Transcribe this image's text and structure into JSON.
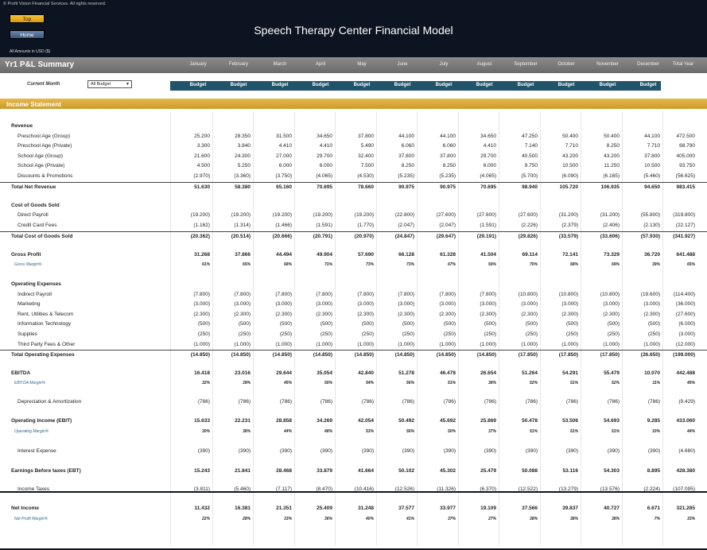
{
  "header": {
    "copyright": "© Profit Vision Financial Services. All rights reserved.",
    "top_button": "Top",
    "home_button": "Home",
    "title": "Speech Therapy Center Financial Model",
    "amounts_note": "All Amounts in  USD ($)"
  },
  "summary": {
    "title": "Yr1 P&L Summary",
    "months": [
      "January",
      "February",
      "March",
      "April",
      "May",
      "June",
      "July",
      "August",
      "September",
      "October",
      "November",
      "December",
      "Total Year"
    ],
    "current_month_label": "Current Month",
    "dropdown_value": "All Budget",
    "budget_label": "Budget"
  },
  "section_title": "Income Statement",
  "rows": [
    {
      "label": "Revenue",
      "style": "head",
      "values": []
    },
    {
      "label": "Preschool Age (Group)",
      "style": "i1",
      "values": [
        "25.200",
        "28.350",
        "31.500",
        "34.650",
        "37.800",
        "44.100",
        "44.100",
        "34.650",
        "47.250",
        "50.400",
        "50.400",
        "44.100",
        "472.500"
      ]
    },
    {
      "label": "Preschool Age (Private)",
      "style": "i1",
      "values": [
        "3.300",
        "3.840",
        "4.410",
        "4.410",
        "5.490",
        "6.060",
        "6.060",
        "4.410",
        "7.140",
        "7.710",
        "8.250",
        "7.710",
        "68.790"
      ]
    },
    {
      "label": "School Age (Group)",
      "style": "i1",
      "values": [
        "21.600",
        "24.300",
        "27.000",
        "29.700",
        "32.400",
        "37.800",
        "37.800",
        "29.700",
        "40.500",
        "43.200",
        "43.200",
        "37.800",
        "405.000"
      ]
    },
    {
      "label": "School Age (Private)",
      "style": "i1",
      "values": [
        "4.500",
        "5.250",
        "6.000",
        "6.000",
        "7.500",
        "8.250",
        "8.250",
        "6.000",
        "9.750",
        "10.500",
        "11.250",
        "10.500",
        "93.750"
      ]
    },
    {
      "label": "Discounts & Promotions",
      "style": "i1",
      "values": [
        "(2.970)",
        "(3.360)",
        "(3.750)",
        "(4.065)",
        "(4.530)",
        "(5.235)",
        "(5.235)",
        "(4.065)",
        "(5.700)",
        "(6.090)",
        "(6.165)",
        "(5.460)",
        "(56.625)"
      ]
    },
    {
      "label": "Total Net Revenue",
      "style": "total",
      "values": [
        "51.630",
        "58.380",
        "65.160",
        "70.695",
        "78.660",
        "90.975",
        "90.975",
        "70.695",
        "98.940",
        "105.720",
        "106.935",
        "94.650",
        "983.415"
      ]
    },
    {
      "label": "Cost of Goods Sold",
      "style": "head",
      "values": []
    },
    {
      "label": "Direct Payroll",
      "style": "i1",
      "values": [
        "(19.200)",
        "(19.200)",
        "(19.200)",
        "(19.200)",
        "(19.200)",
        "(22.800)",
        "(27.600)",
        "(27.600)",
        "(27.600)",
        "(31.200)",
        "(31.200)",
        "(55.800)",
        "(319.800)"
      ]
    },
    {
      "label": "Credit Card Fees",
      "style": "i1",
      "values": [
        "(1.162)",
        "(1.314)",
        "(1.466)",
        "(1.591)",
        "(1.770)",
        "(2.047)",
        "(2.047)",
        "(1.591)",
        "(2.226)",
        "(2.379)",
        "(2.406)",
        "(2.130)",
        "(22.127)"
      ]
    },
    {
      "label": "Total Cost of Goods Sold",
      "style": "total",
      "values": [
        "(20.362)",
        "(20.514)",
        "(20.666)",
        "(20.791)",
        "(20.970)",
        "(24.847)",
        "(29.647)",
        "(29.191)",
        "(29.826)",
        "(33.579)",
        "(33.606)",
        "(57.930)",
        "(341.927)"
      ]
    },
    {
      "label": "Gross Profit",
      "style": "bold",
      "values": [
        "31.268",
        "37.866",
        "44.494",
        "49.904",
        "57.690",
        "66.128",
        "61.328",
        "41.504",
        "69.114",
        "72.141",
        "73.329",
        "36.720",
        "641.488"
      ]
    },
    {
      "label": "Gross Margin%",
      "style": "margin",
      "values": [
        "61%",
        "65%",
        "68%",
        "71%",
        "73%",
        "73%",
        "67%",
        "59%",
        "70%",
        "68%",
        "69%",
        "39%",
        "65%"
      ]
    },
    {
      "label": "Operating Expenses",
      "style": "head",
      "values": []
    },
    {
      "label": "Indirect Payroll",
      "style": "i1",
      "values": [
        "(7.800)",
        "(7.800)",
        "(7.800)",
        "(7.800)",
        "(7.800)",
        "(7.800)",
        "(7.800)",
        "(7.800)",
        "(10.800)",
        "(10.800)",
        "(10.800)",
        "(19.600)",
        "(114.400)"
      ]
    },
    {
      "label": "Marketing",
      "style": "i1",
      "values": [
        "(3.000)",
        "(3.000)",
        "(3.000)",
        "(3.000)",
        "(3.000)",
        "(3.000)",
        "(3.000)",
        "(3.000)",
        "(3.000)",
        "(3.000)",
        "(3.000)",
        "(3.000)",
        "(36.000)"
      ]
    },
    {
      "label": "Rent, Utilities & Telecom",
      "style": "i1",
      "values": [
        "(2.300)",
        "(2.300)",
        "(2.300)",
        "(2.300)",
        "(2.300)",
        "(2.300)",
        "(2.300)",
        "(2.300)",
        "(2.300)",
        "(2.300)",
        "(2.300)",
        "(2.300)",
        "(27.600)"
      ]
    },
    {
      "label": "Information Technology",
      "style": "i1",
      "values": [
        "(500)",
        "(500)",
        "(500)",
        "(500)",
        "(500)",
        "(500)",
        "(500)",
        "(500)",
        "(500)",
        "(500)",
        "(500)",
        "(500)",
        "(6.000)"
      ]
    },
    {
      "label": "Supplies",
      "style": "i1",
      "values": [
        "(250)",
        "(250)",
        "(250)",
        "(250)",
        "(250)",
        "(250)",
        "(250)",
        "(250)",
        "(250)",
        "(250)",
        "(250)",
        "(250)",
        "(3.000)"
      ]
    },
    {
      "label": "Third Party Fees & Other",
      "style": "i1",
      "values": [
        "(1.000)",
        "(1.000)",
        "(1.000)",
        "(1.000)",
        "(1.000)",
        "(1.000)",
        "(1.000)",
        "(1.000)",
        "(1.000)",
        "(1.000)",
        "(1.000)",
        "(1.000)",
        "(12.000)"
      ]
    },
    {
      "label": "Total Operating Expenses",
      "style": "total",
      "values": [
        "(14.850)",
        "(14.850)",
        "(14.850)",
        "(14.850)",
        "(14.850)",
        "(14.850)",
        "(14.850)",
        "(14.850)",
        "(17.850)",
        "(17.850)",
        "(17.850)",
        "(26.650)",
        "(199.000)"
      ]
    },
    {
      "label": "EBITDA",
      "style": "bold",
      "values": [
        "16.418",
        "23.016",
        "29.644",
        "35.054",
        "42.840",
        "51.278",
        "46.478",
        "26.654",
        "51.264",
        "54.291",
        "55.479",
        "10.070",
        "442.488"
      ]
    },
    {
      "label": "EBITDA Margin%",
      "style": "margin",
      "values": [
        "32%",
        "39%",
        "45%",
        "50%",
        "54%",
        "56%",
        "51%",
        "38%",
        "52%",
        "51%",
        "52%",
        "11%",
        "45%"
      ]
    },
    {
      "label": "Depreciation & Amortization",
      "style": "i1",
      "values": [
        "(786)",
        "(786)",
        "(786)",
        "(786)",
        "(786)",
        "(786)",
        "(786)",
        "(786)",
        "(786)",
        "(786)",
        "(786)",
        "(786)",
        "(9.429)"
      ]
    },
    {
      "label": "Operating Income (EBIT)",
      "style": "bold",
      "values": [
        "15.633",
        "22.231",
        "28.858",
        "34.269",
        "42.054",
        "50.492",
        "45.692",
        "25.869",
        "50.478",
        "53.506",
        "54.693",
        "9.285",
        "433.060"
      ]
    },
    {
      "label": "Operating Margin%",
      "style": "margin",
      "values": [
        "30%",
        "38%",
        "44%",
        "48%",
        "53%",
        "56%",
        "50%",
        "37%",
        "51%",
        "51%",
        "51%",
        "10%",
        "44%"
      ]
    },
    {
      "label": "Interest Expense",
      "style": "i1",
      "values": [
        "(390)",
        "(390)",
        "(390)",
        "(390)",
        "(390)",
        "(390)",
        "(390)",
        "(390)",
        "(390)",
        "(390)",
        "(390)",
        "(390)",
        "(4.680)"
      ]
    },
    {
      "label": "Earnings Before taxes (EBT)",
      "style": "bold",
      "values": [
        "15.243",
        "21.841",
        "28.468",
        "33.879",
        "41.664",
        "50.102",
        "45.302",
        "25.479",
        "50.088",
        "53.116",
        "54.303",
        "8.895",
        "428.380"
      ]
    },
    {
      "label": "Income Taxes",
      "style": "i1",
      "values": [
        "(3.811)",
        "(5.460)",
        "(7.117)",
        "(8.470)",
        "(10.416)",
        "(12.526)",
        "(11.326)",
        "(6.370)",
        "(12.522)",
        "(13.279)",
        "(13.576)",
        "(2.224)",
        "(107.095)"
      ]
    },
    {
      "label": "Net Income",
      "style": "bold",
      "values": [
        "11.432",
        "16.381",
        "21.351",
        "25.409",
        "31.248",
        "37.577",
        "33.977",
        "19.109",
        "37.566",
        "39.837",
        "40.727",
        "6.671",
        "321.285"
      ]
    },
    {
      "label": "Net Profit Margin%",
      "style": "margin",
      "values": [
        "22%",
        "28%",
        "33%",
        "36%",
        "40%",
        "41%",
        "37%",
        "27%",
        "38%",
        "38%",
        "38%",
        "7%",
        "33%"
      ]
    }
  ]
}
